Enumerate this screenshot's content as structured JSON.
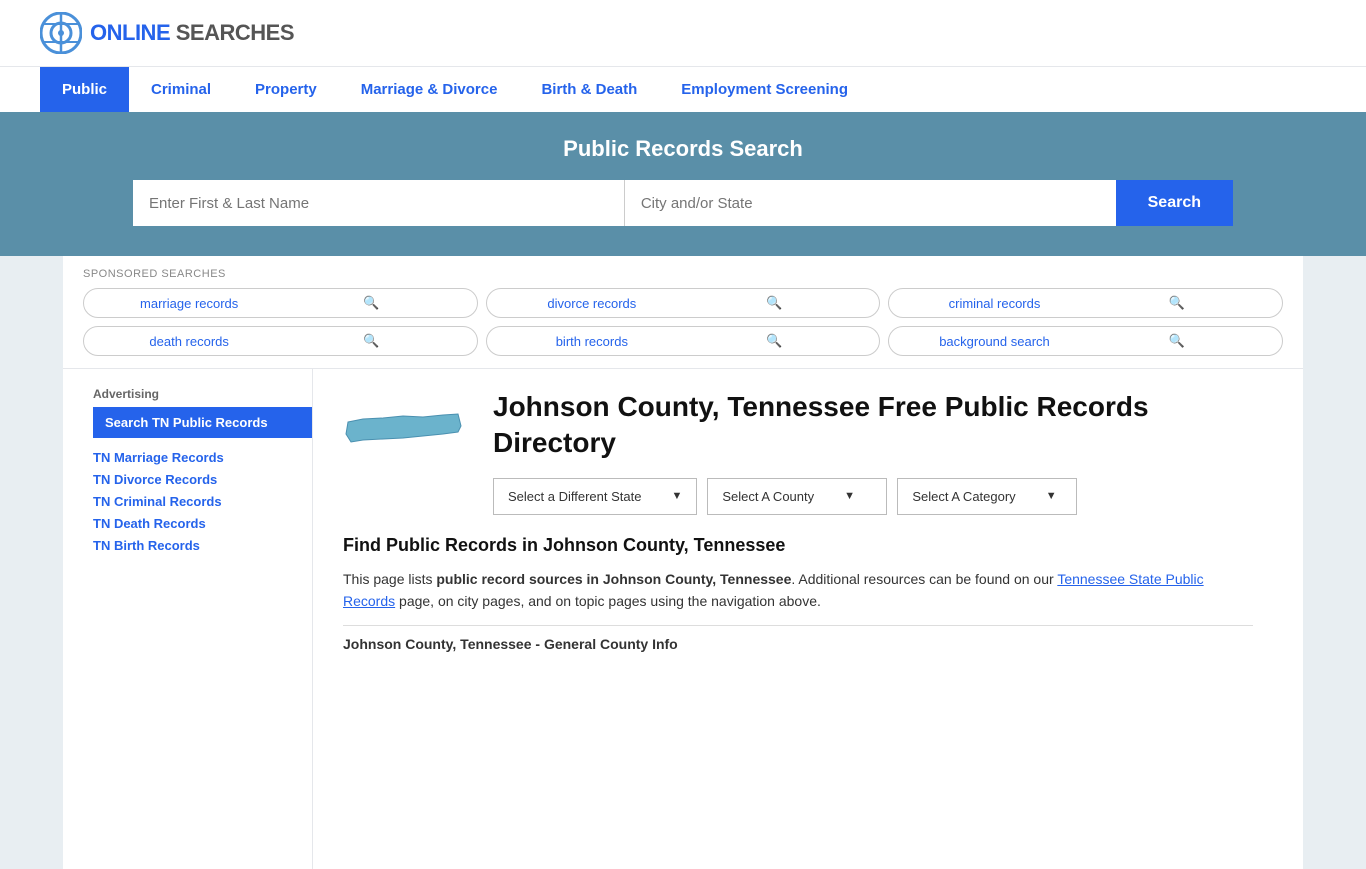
{
  "logo": {
    "text_online": "ONLINE",
    "text_searches": "SEARCHES"
  },
  "nav": {
    "items": [
      {
        "label": "Public",
        "active": true
      },
      {
        "label": "Criminal",
        "active": false
      },
      {
        "label": "Property",
        "active": false
      },
      {
        "label": "Marriage & Divorce",
        "active": false
      },
      {
        "label": "Birth & Death",
        "active": false
      },
      {
        "label": "Employment Screening",
        "active": false
      }
    ]
  },
  "hero": {
    "title": "Public Records Search",
    "name_placeholder": "Enter First & Last Name",
    "location_placeholder": "City and/or State",
    "search_button": "Search"
  },
  "sponsored": {
    "label": "SPONSORED SEARCHES",
    "pills": [
      "marriage records",
      "divorce records",
      "criminal records",
      "death records",
      "birth records",
      "background search"
    ]
  },
  "state_section": {
    "heading": "Johnson County, Tennessee Free Public Records Directory",
    "dropdowns": {
      "state": "Select a Different State",
      "county": "Select A County",
      "category": "Select A Category"
    }
  },
  "content": {
    "find_title": "Find Public Records in Johnson County, Tennessee",
    "find_desc_part1": "This page lists ",
    "find_desc_bold1": "public record sources in Johnson County, Tennessee",
    "find_desc_part2": ". Additional resources can be found on our ",
    "find_desc_link": "Tennessee State Public Records",
    "find_desc_part3": " page, on city pages, and on topic pages using the navigation above.",
    "general_info": "Johnson County, Tennessee - General County Info"
  },
  "sidebar": {
    "ad_label": "Advertising",
    "featured": "Search TN Public Records",
    "links": [
      "TN Marriage Records",
      "TN Divorce Records",
      "TN Criminal Records",
      "TN Death Records",
      "TN Birth Records"
    ]
  }
}
